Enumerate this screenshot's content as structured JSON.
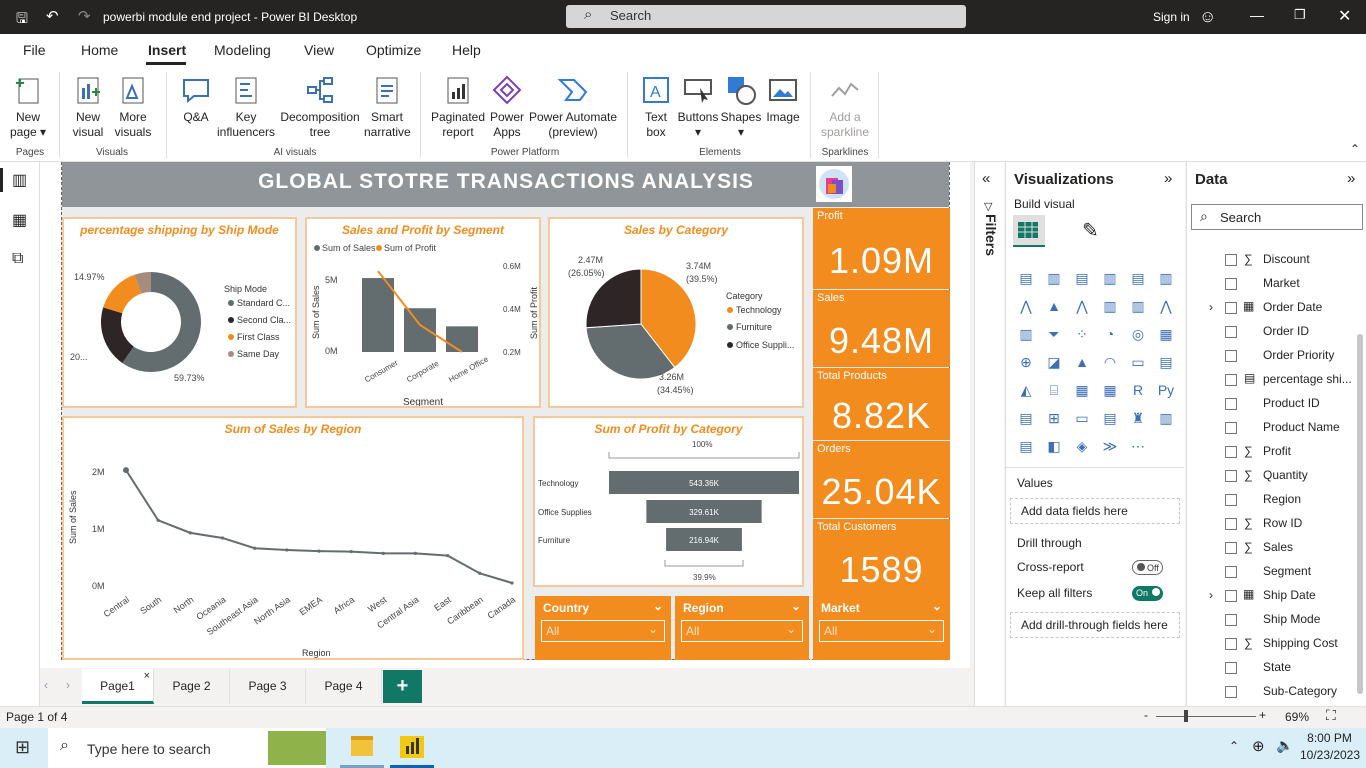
{
  "window": {
    "title": "powerbi module end project - Power BI Desktop",
    "search": "Search",
    "signin": "Sign in"
  },
  "menu": [
    "File",
    "Home",
    "Insert",
    "Modeling",
    "View",
    "Optimize",
    "Help"
  ],
  "ribbon": {
    "buttons": [
      {
        "label": "New\npage",
        "name": "new-page-button"
      },
      {
        "label": "New\nvisual",
        "name": "new-visual-button"
      },
      {
        "label": "More\nvisuals",
        "name": "more-visuals-button"
      },
      {
        "label": "Q&A",
        "name": "qna-button"
      },
      {
        "label": "Key\ninfluencers",
        "name": "key-influencers-button"
      },
      {
        "label": "Decomposition\ntree",
        "name": "decomposition-tree-button"
      },
      {
        "label": "Smart\nnarrative",
        "name": "smart-narrative-button"
      },
      {
        "label": "Paginated\nreport",
        "name": "paginated-report-button"
      },
      {
        "label": "Power\nApps",
        "name": "power-apps-button"
      },
      {
        "label": "Power Automate\n(preview)",
        "name": "power-automate-button"
      },
      {
        "label": "Text\nbox",
        "name": "text-box-button"
      },
      {
        "label": "Buttons",
        "name": "buttons-button"
      },
      {
        "label": "Shapes",
        "name": "shapes-button"
      },
      {
        "label": "Image",
        "name": "image-button"
      },
      {
        "label": "Add a\nsparkline",
        "name": "add-sparkline-button"
      }
    ],
    "groups": [
      "Pages",
      "Visuals",
      "AI visuals",
      "Power Platform",
      "Elements",
      "Sparklines"
    ]
  },
  "report": {
    "title": "GLOBAL STOTRE TRANSACTIONS ANALYSIS",
    "kpis": [
      {
        "label": "Profit",
        "value": "1.09M"
      },
      {
        "label": "Sales",
        "value": "9.48M"
      },
      {
        "label": "Total Products",
        "value": "8.82K"
      },
      {
        "label": "Orders",
        "value": "25.04K"
      },
      {
        "label": "Total Customers",
        "value": "1589"
      }
    ],
    "slicers": [
      {
        "label": "Country",
        "value": "All"
      },
      {
        "label": "Region",
        "value": "All"
      },
      {
        "label": "Market",
        "value": "All"
      }
    ],
    "donut": {
      "title": "percentage shipping by Ship Mode",
      "legend_title": "Ship Mode",
      "legend": [
        "Standard C...",
        "Second Cla...",
        "First Class",
        "Same Day"
      ],
      "labels": [
        "14.97%",
        "20...",
        "59.73%"
      ]
    },
    "segment": {
      "title": "Sales and Profit by Segment",
      "legend": [
        "Sum of Sales",
        "Sum of Profit"
      ],
      "xlabel": "Segment",
      "ylabel": "Sum of Sales",
      "y2label": "Sum of Profit",
      "yticks": [
        "5M",
        "0M"
      ],
      "y2ticks": [
        "0.6M",
        "0.4M",
        "0.2M"
      ]
    },
    "category_pie": {
      "title": "Sales by Category",
      "legend_title": "Category",
      "legend": [
        "Technology",
        "Furniture",
        "Office Suppli..."
      ],
      "labels": [
        [
          "2.47M",
          "(26.05%)"
        ],
        [
          "3.74M",
          "(39.5%)"
        ],
        [
          "3.26M",
          "(34.45%)"
        ]
      ]
    },
    "region": {
      "title": "Sum of Sales by Region",
      "xlabel": "Region",
      "ylabel": "Sum of Sales",
      "yticks": [
        "2M",
        "1M",
        "0M"
      ]
    },
    "funnel": {
      "title": "Sum of Profit by Category",
      "top": "100%",
      "bottom": "39.9%"
    }
  },
  "chart_data": [
    {
      "type": "pie",
      "title": "percentage shipping by Ship Mode",
      "categories": [
        "Standard Class",
        "Second Class",
        "First Class",
        "Same Day"
      ],
      "values": [
        59.73,
        20.0,
        14.97,
        5.3
      ]
    },
    {
      "type": "bar",
      "title": "Sales and Profit by Segment",
      "categories": [
        "Consumer",
        "Corporate",
        "Home Office"
      ],
      "series": [
        {
          "name": "Sum of Sales",
          "values": [
            4.9,
            2.9,
            1.7
          ]
        },
        {
          "name": "Sum of Profit",
          "values": [
            0.59,
            0.33,
            0.17
          ]
        }
      ]
    },
    {
      "type": "pie",
      "title": "Sales by Category",
      "categories": [
        "Technology",
        "Furniture",
        "Office Supplies"
      ],
      "values": [
        3.74,
        3.26,
        2.47
      ]
    },
    {
      "type": "line",
      "title": "Sum of Sales by Region",
      "xlabel": "Region",
      "ylabel": "Sum of Sales",
      "categories": [
        "Central",
        "South",
        "North",
        "Oceania",
        "Southeast Asia",
        "North Asia",
        "EMEA",
        "Africa",
        "West",
        "Central Asia",
        "East",
        "Caribbean",
        "Canada"
      ],
      "values": [
        2.05,
        1.17,
        0.95,
        0.86,
        0.68,
        0.65,
        0.63,
        0.62,
        0.59,
        0.59,
        0.55,
        0.24,
        0.07
      ],
      "ylim": [
        0,
        2
      ]
    },
    {
      "type": "bar",
      "title": "Sum of Profit by Category",
      "categories": [
        "Technology",
        "Office Supplies",
        "Furniture"
      ],
      "values": [
        543.36,
        329.61,
        216.94
      ],
      "labels": [
        "543.36K",
        "329.61K",
        "216.94K"
      ]
    }
  ],
  "pages": {
    "tabs": [
      "Page1",
      "Page 2",
      "Page 3",
      "Page 4"
    ],
    "status": "Page 1 of 4",
    "zoom": "69%"
  },
  "panes": {
    "filters": "Filters",
    "viz_title": "Visualizations",
    "build": "Build visual",
    "values": "Values",
    "add_data": "Add data fields here",
    "drill": "Drill through",
    "cross": "Cross-report",
    "cross_state": "Off",
    "keep": "Keep all filters",
    "keep_state": "On",
    "add_drill": "Add drill-through fields here",
    "data_title": "Data",
    "data_search": "Search",
    "fields": [
      "Discount",
      "Market",
      "Order Date",
      "Order ID",
      "Order Priority",
      "percentage shi...",
      "Product ID",
      "Product Name",
      "Profit",
      "Quantity",
      "Region",
      "Row ID",
      "Sales",
      "Segment",
      "Ship Date",
      "Ship Mode",
      "Shipping Cost",
      "State",
      "Sub-Category"
    ],
    "sigma": [
      true,
      false,
      false,
      false,
      false,
      false,
      false,
      false,
      true,
      true,
      false,
      true,
      true,
      false,
      false,
      false,
      true,
      false,
      false
    ]
  },
  "taskbar": {
    "search": "Type here to search",
    "time": "8:00 PM",
    "date": "10/23/2023"
  },
  "colors": {
    "orange": "#f28c1e",
    "gray": "#636c6f",
    "dark": "#2e2626",
    "tan": "#a78b7c"
  }
}
